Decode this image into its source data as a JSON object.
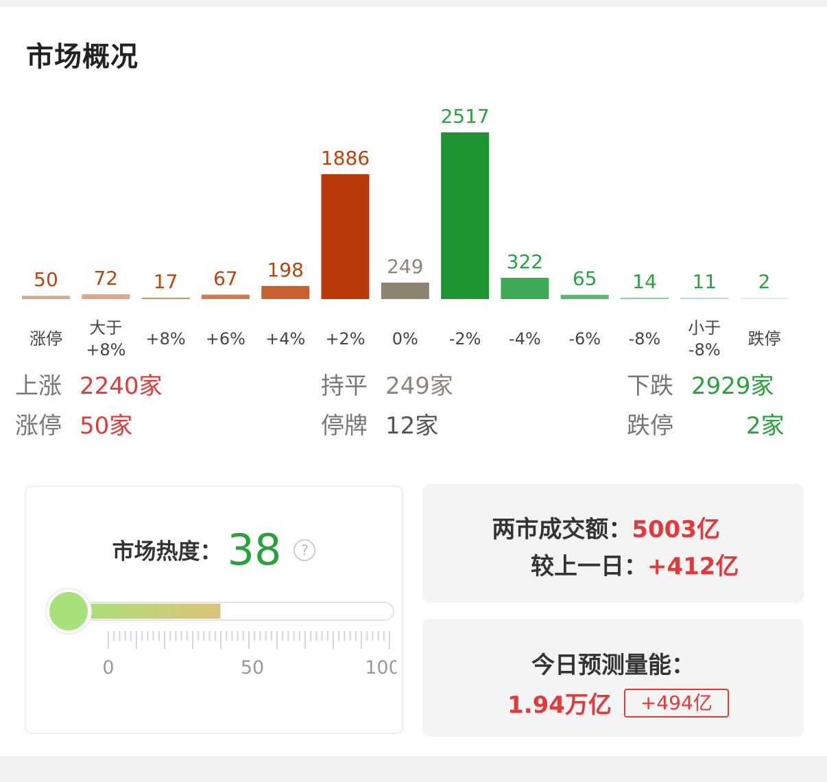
{
  "title": "市场概况",
  "chart_data": {
    "type": "bar",
    "categories": [
      "涨停",
      "大于\n+8%",
      "+8%",
      "+6%",
      "+4%",
      "+2%",
      "0%",
      "-2%",
      "-4%",
      "-6%",
      "-8%",
      "小于\n-8%",
      "跌停"
    ],
    "values": [
      50,
      72,
      17,
      67,
      198,
      1886,
      249,
      2517,
      322,
      65,
      14,
      11,
      2
    ],
    "colors": [
      "#e0a68a",
      "#e0a68a",
      "#d98c66",
      "#d4784f",
      "#c9602f",
      "#b83a0a",
      "#8c8371",
      "#1e9432",
      "#3faa55",
      "#5cb870",
      "#8bcf9a",
      "#b6e0bf",
      "#d9efdd"
    ],
    "label_colors": [
      "#b8450f",
      "#b8450f",
      "#b8450f",
      "#b8450f",
      "#b8450f",
      "#b8450f",
      "#8d8679",
      "#27a33d",
      "#27a33d",
      "#27a33d",
      "#27a33d",
      "#27a33d",
      "#27a33d"
    ]
  },
  "stats": {
    "up_label": "上涨",
    "up_value": "2240家",
    "flat_label": "持平",
    "flat_value": "249家",
    "down_label": "下跌",
    "down_value": "2929家",
    "limit_up_label": "涨停",
    "limit_up_value": "50家",
    "suspend_label": "停牌",
    "suspend_value": "12家",
    "limit_down_label": "跌停",
    "limit_down_value": "2家"
  },
  "heat": {
    "label": "市场热度：",
    "value": 38,
    "help_icon": "question-circle-icon",
    "scale_labels": [
      "0",
      "50",
      "100"
    ]
  },
  "turnover": {
    "label": "两市成交额：",
    "value": "5003亿",
    "change_label": "较上一日：",
    "change_value": "+412亿"
  },
  "prediction": {
    "label": "今日预测量能：",
    "value": "1.94万亿",
    "change": "+494亿"
  }
}
